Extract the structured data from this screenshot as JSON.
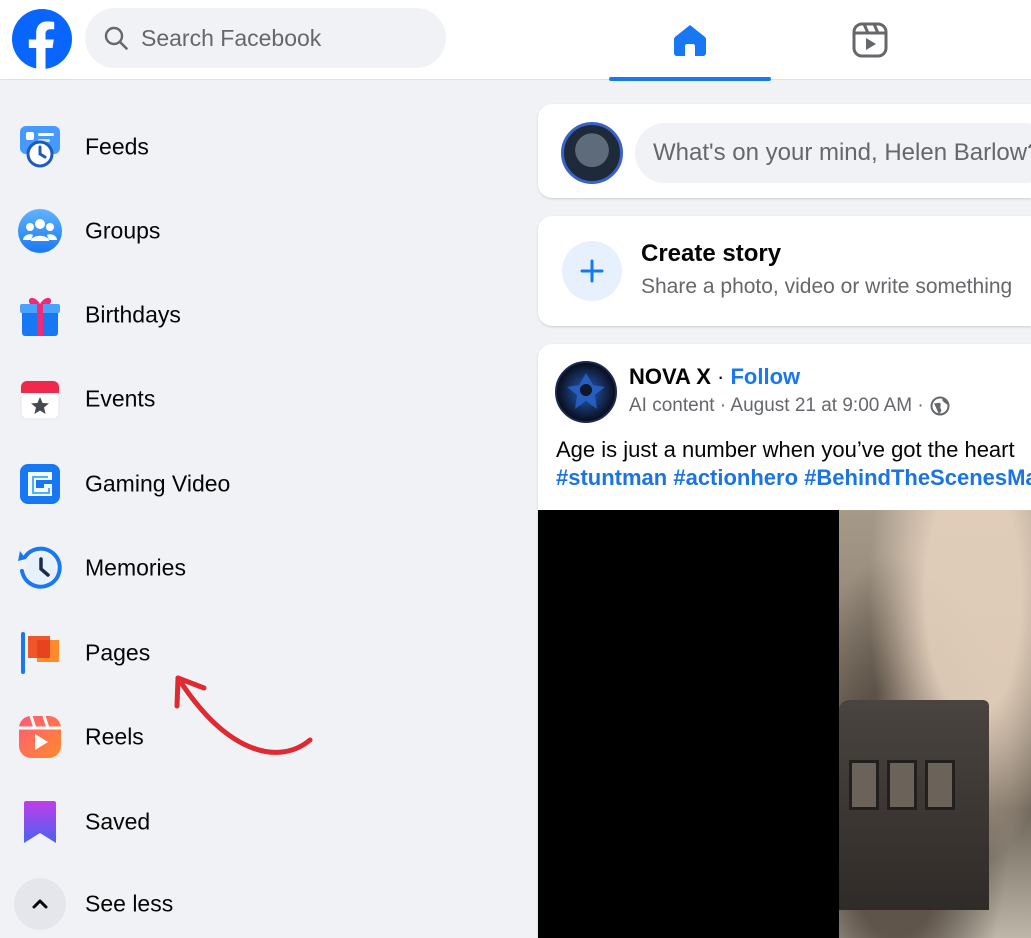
{
  "header": {
    "search_placeholder": "Search Facebook",
    "nav": [
      {
        "name": "home",
        "active": true
      },
      {
        "name": "reels",
        "active": false
      }
    ],
    "accent_color": "#1877f2"
  },
  "sidebar": {
    "items": [
      {
        "label": "Feeds",
        "icon": "feeds-icon"
      },
      {
        "label": "Groups",
        "icon": "groups-icon"
      },
      {
        "label": "Birthdays",
        "icon": "gift-icon"
      },
      {
        "label": "Events",
        "icon": "calendar-star-icon"
      },
      {
        "label": "Gaming Video",
        "icon": "gaming-video-icon"
      },
      {
        "label": "Memories",
        "icon": "memories-clock-icon"
      },
      {
        "label": "Pages",
        "icon": "flag-icon"
      },
      {
        "label": "Reels",
        "icon": "reels-play-icon"
      },
      {
        "label": "Saved",
        "icon": "bookmark-icon"
      }
    ],
    "see_less": {
      "label": "See less",
      "icon": "chevron-up-icon"
    }
  },
  "composer": {
    "placeholder": "What's on your mind, Helen Barlow?"
  },
  "story": {
    "title": "Create story",
    "subtitle": "Share a photo, video or write something"
  },
  "post": {
    "author": "NOVA X",
    "separator": "·",
    "follow_label": "Follow",
    "meta": "AI content · August 21 at 9:00 AM ·",
    "privacy_icon": "globe-icon",
    "text": "Age is just a number when you’ve got the heart",
    "hashtags": "#stuntman #actionhero #BehindTheScenesMagic"
  }
}
